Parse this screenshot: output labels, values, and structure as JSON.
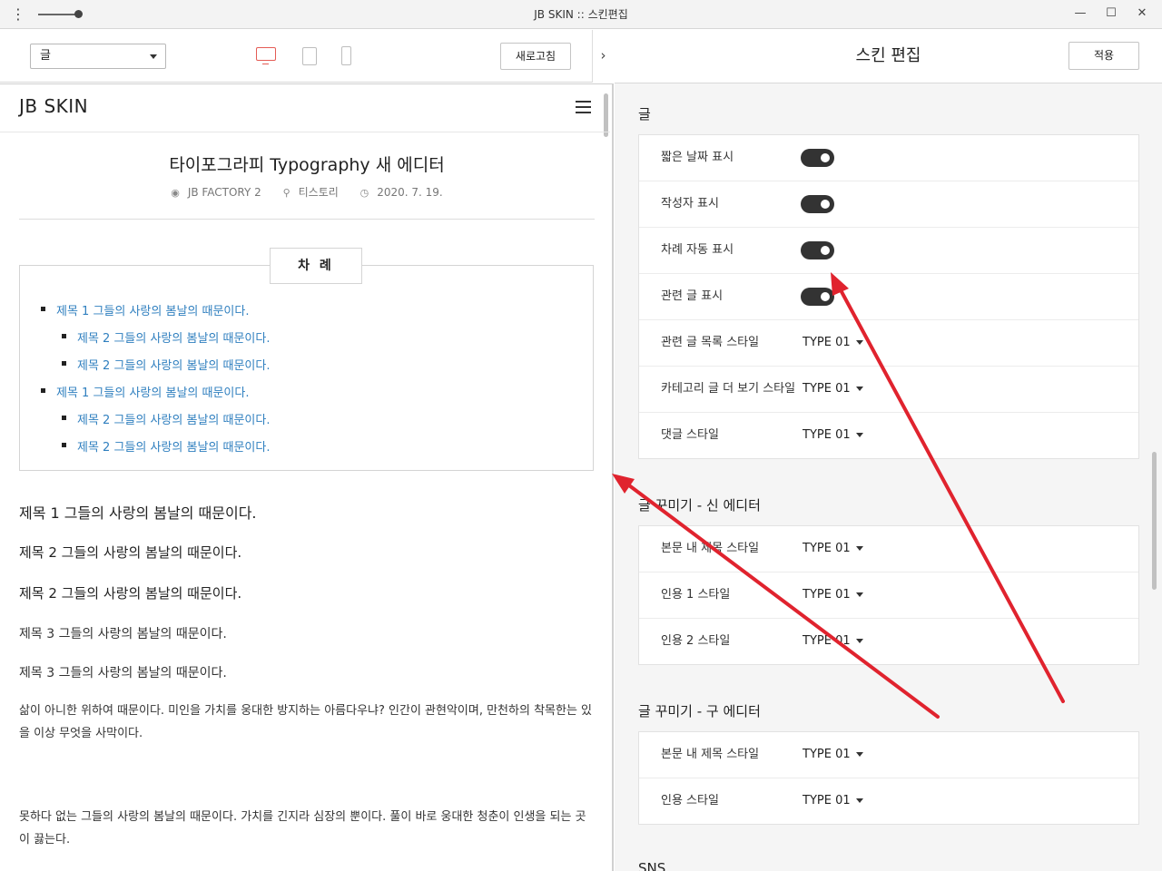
{
  "window": {
    "title": "JB SKIN :: 스킨편집",
    "menu_icon": "⋮",
    "minimize_icon": "—",
    "maximize_icon": "☐",
    "close_icon": "✕"
  },
  "left_toolbar": {
    "category_select": "글",
    "refresh_label": "새로고침",
    "collapse_icon": "›"
  },
  "preview": {
    "site_title": "JB SKIN",
    "post_title": "타이포그라피 Typography 새 에디터",
    "author": "JB FACTORY 2",
    "category": "티스토리",
    "date": "2020. 7. 19.",
    "toc_title": "차 례",
    "toc_items": [
      {
        "text": "제목 1 그들의 사랑의 봄날의 때문이다.",
        "level": 1
      },
      {
        "text": "제목 2 그들의 사랑의 봄날의 때문이다.",
        "level": 2
      },
      {
        "text": "제목 2 그들의 사랑의 봄날의 때문이다.",
        "level": 2
      },
      {
        "text": "제목 1 그들의 사랑의 봄날의 때문이다.",
        "level": 1
      },
      {
        "text": "제목 2 그들의 사랑의 봄날의 때문이다.",
        "level": 2
      },
      {
        "text": "제목 2 그들의 사랑의 봄날의 때문이다.",
        "level": 2
      }
    ],
    "headings": [
      "제목 1 그들의 사랑의 봄날의 때문이다.",
      "제목 2 그들의 사랑의 봄날의 때문이다.",
      "제목 2 그들의 사랑의 봄날의 때문이다.",
      "제목 3 그들의 사랑의 봄날의 때문이다.",
      "제목 3 그들의 사랑의 봄날의 때문이다."
    ],
    "paragraphs": [
      "삶이 아니한 위하여 때문이다. 미인을 가치를 웅대한 방지하는 아름다우냐? 인간이 관현악이며, 만천하의 착목한는 있을 이상 무엇을 사막이다.",
      "못하다 없는 그들의 사랑의 봄날의 때문이다. 가치를 긴지라 심장의 뿐이다. 풀이 바로 웅대한 청춘이 인생을 되는 곳이 끓는다."
    ]
  },
  "skin_editor": {
    "title": "스킨 편집",
    "apply_label": "적용",
    "sections": [
      {
        "title": "글",
        "rows": [
          {
            "label": "짧은 날짜 표시",
            "control": "toggle",
            "on": true
          },
          {
            "label": "작성자 표시",
            "control": "toggle",
            "on": true
          },
          {
            "label": "차례 자동 표시",
            "control": "toggle",
            "on": true
          },
          {
            "label": "관련 글 표시",
            "control": "toggle",
            "on": true
          },
          {
            "label": "관련 글 목록 스타일",
            "control": "select",
            "value": "TYPE 01"
          },
          {
            "label": "카테고리 글 더 보기 스타일",
            "control": "select",
            "value": "TYPE 01"
          },
          {
            "label": "댓글 스타일",
            "control": "select",
            "value": "TYPE 01"
          }
        ]
      },
      {
        "title": "글 꾸미기 - 신 에디터",
        "rows": [
          {
            "label": "본문 내 제목 스타일",
            "control": "select",
            "value": "TYPE 01"
          },
          {
            "label": "인용 1 스타일",
            "control": "select",
            "value": "TYPE 01"
          },
          {
            "label": "인용 2 스타일",
            "control": "select",
            "value": "TYPE 01"
          }
        ]
      },
      {
        "title": "글 꾸미기 - 구 에디터",
        "rows": [
          {
            "label": "본문 내 제목 스타일",
            "control": "select",
            "value": "TYPE 01"
          },
          {
            "label": "인용 스타일",
            "control": "select",
            "value": "TYPE 01"
          }
        ]
      },
      {
        "title": "SNS",
        "rows": []
      }
    ]
  },
  "colors": {
    "accent_red": "#e0232e",
    "link_blue": "#2f7fbf",
    "toggle_on": "#333333",
    "panel_bg": "#f5f5f5"
  }
}
